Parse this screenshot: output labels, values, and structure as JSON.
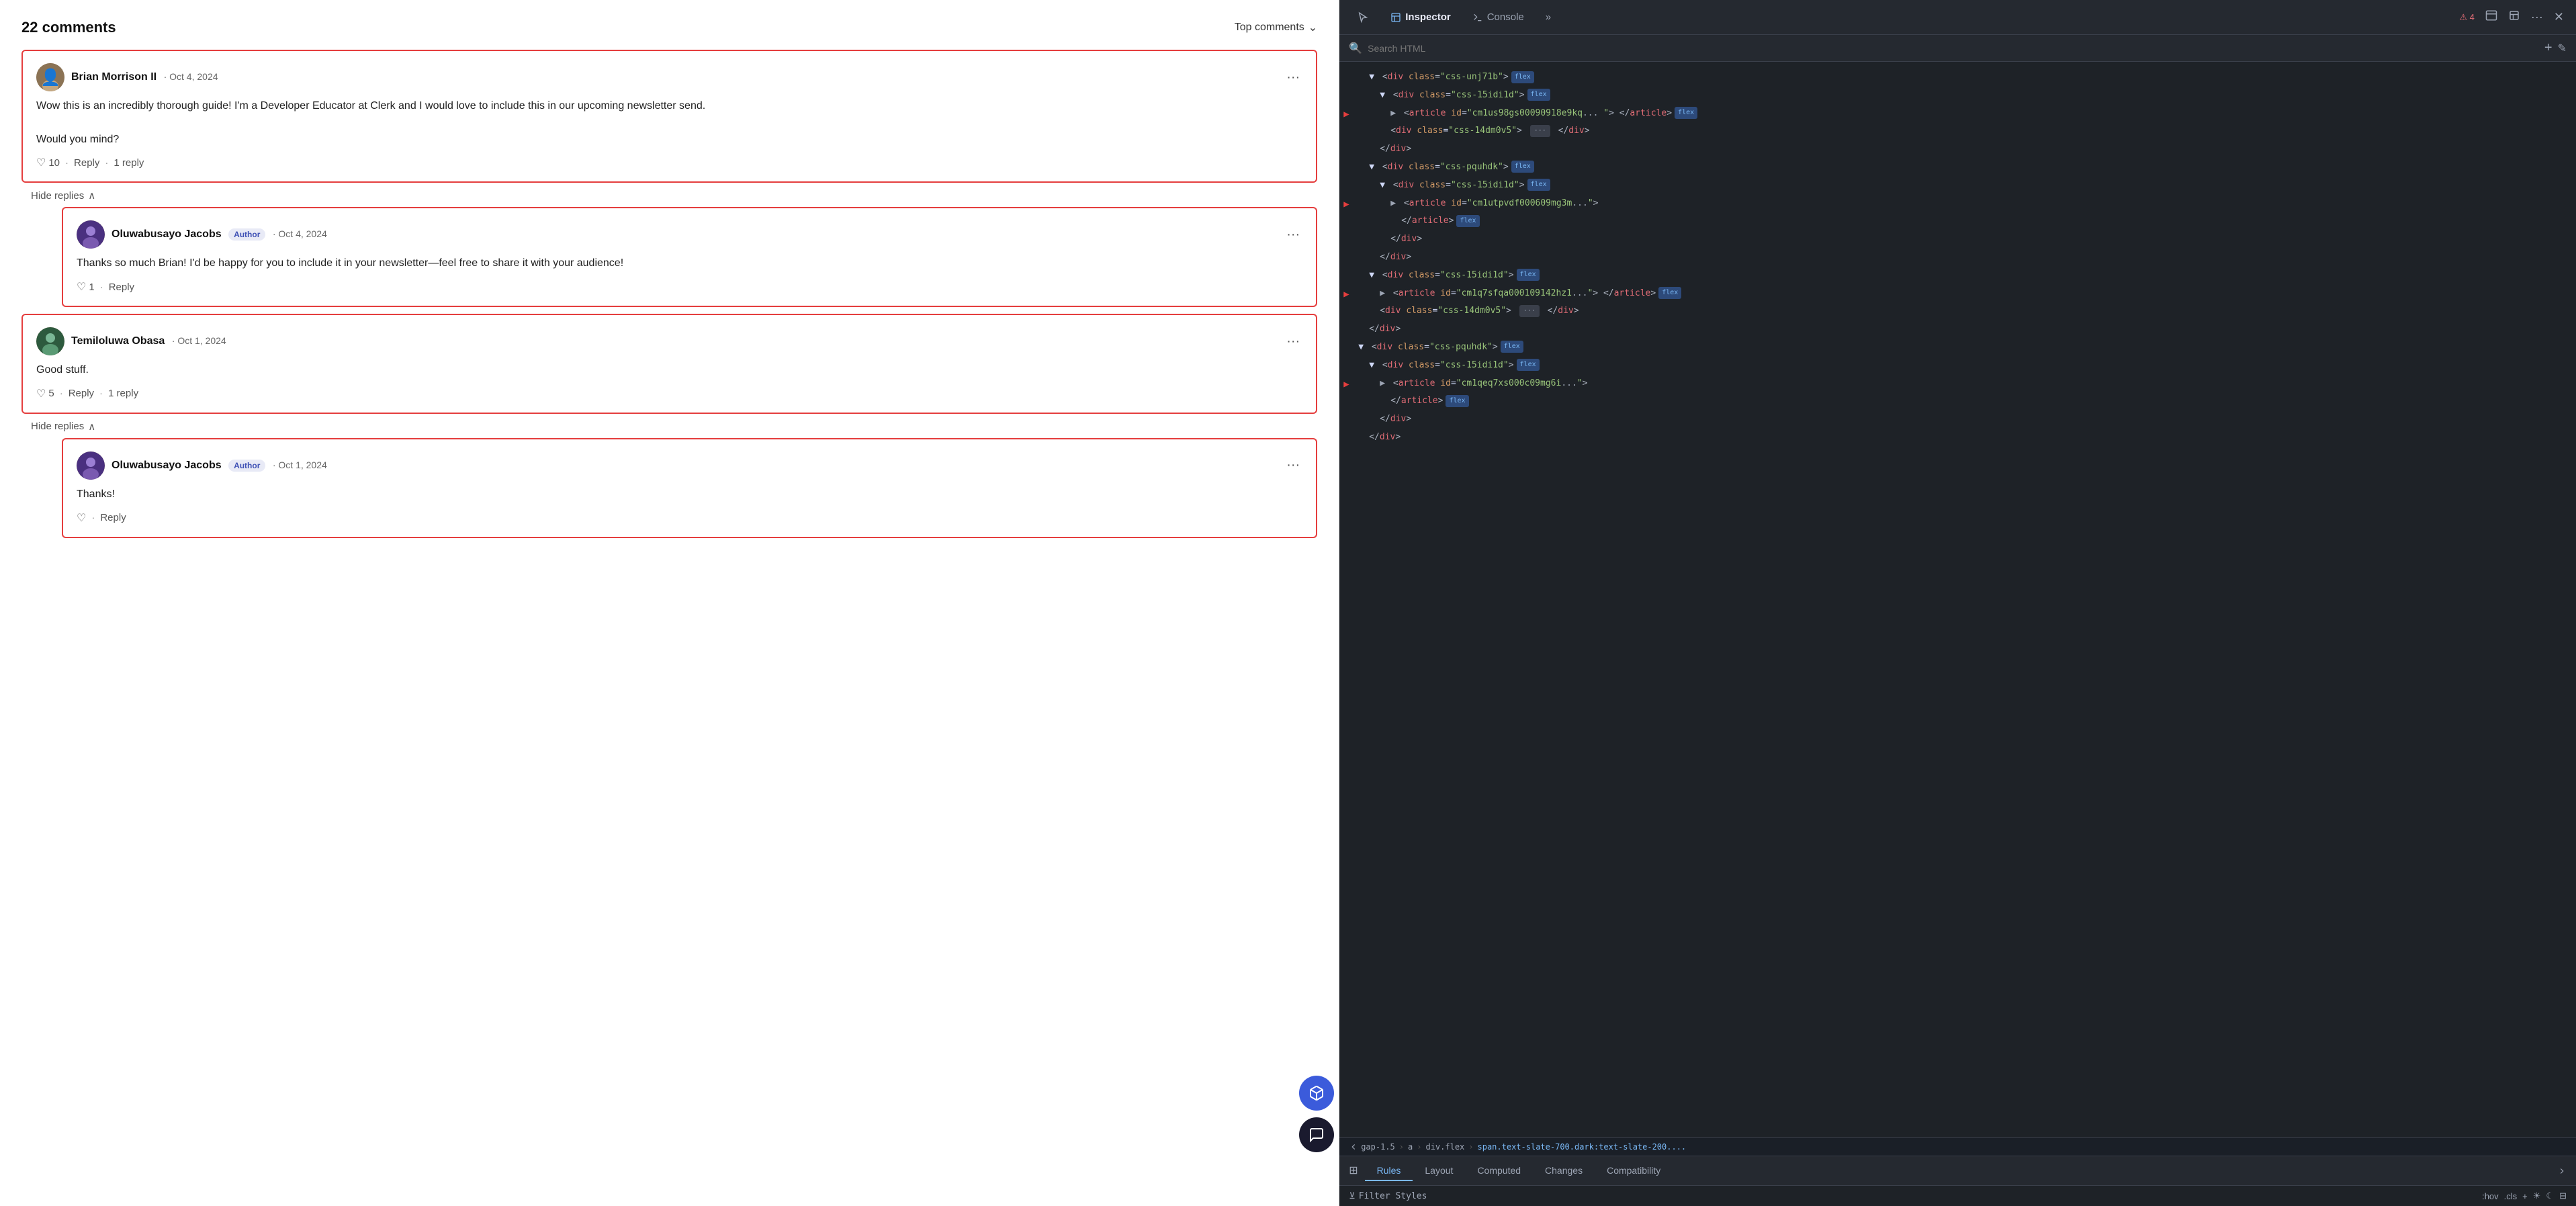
{
  "header": {
    "comments_count": "22 comments",
    "top_comments_label": "Top comments",
    "chevron": "⌄"
  },
  "comments": [
    {
      "id": "comment-1",
      "author": "Brian Morrison II",
      "author_badge": null,
      "date": "Oct 4, 2024",
      "body_lines": [
        "Wow this is an incredibly thorough guide! I'm a Developer Educator at Clerk and I would love to include this in our upcoming newsletter send.",
        "",
        "Would you mind?"
      ],
      "likes": "10",
      "reply_label": "Reply",
      "replies_count": "1 reply",
      "avatar_type": "brian"
    },
    {
      "id": "reply-1",
      "author": "Oluwabusayo Jacobs",
      "author_badge": "Author",
      "date": "Oct 4, 2024",
      "body_lines": [
        "Thanks so much Brian! I'd be happy for you to include it in your newsletter—feel free to share it with your audience!"
      ],
      "likes": "1",
      "reply_label": "Reply",
      "replies_count": null,
      "is_reply": true,
      "avatar_type": "oluwabusayo"
    },
    {
      "id": "comment-2",
      "author": "Temiloluwa Obasa",
      "author_badge": null,
      "date": "Oct 1, 2024",
      "body_lines": [
        "Good stuff."
      ],
      "likes": "5",
      "reply_label": "Reply",
      "replies_count": "1 reply",
      "avatar_type": "temiloluwa"
    },
    {
      "id": "reply-2",
      "author": "Oluwabusayo Jacobs",
      "author_badge": "Author",
      "date": "Oct 1, 2024",
      "body_lines": [
        "Thanks!"
      ],
      "likes": "",
      "reply_label": "Reply",
      "replies_count": null,
      "is_reply": true,
      "avatar_type": "oluwabusayo"
    }
  ],
  "hide_replies_label": "Hide replies",
  "hide_replies_icon": "∧",
  "devtools": {
    "title": "Inspector",
    "tabs": [
      {
        "id": "pick",
        "icon": "⊹",
        "label": ""
      },
      {
        "id": "inspector",
        "label": "Inspector",
        "active": true
      },
      {
        "id": "console",
        "label": "Console"
      },
      {
        "id": "more",
        "icon": "»"
      }
    ],
    "error_badge": "⚠4",
    "search_placeholder": "Search HTML",
    "add_btn": "+",
    "edit_btn": "✎",
    "html_lines": [
      {
        "indent": 2,
        "content": "<div class=\"css-unj71b\">",
        "badge": "flex",
        "type": "open",
        "partial": true
      },
      {
        "indent": 3,
        "content": "<div class=\"css-15idi1d\">",
        "badge": "flex",
        "type": "open"
      },
      {
        "indent": 4,
        "content": "<article id=\"cm1us98gs00090918e9kq...",
        "badge": "flex",
        "type": "arrow-open",
        "arrow": true
      },
      {
        "indent": 5,
        "content": "article>",
        "badge": "flex",
        "type": "close-inline"
      },
      {
        "indent": 4,
        "content": "<div class=\"css-14dm0v5\">",
        "badge": null,
        "dots": true,
        "type": "self-close"
      },
      {
        "indent": 3,
        "content": "</div>",
        "type": "close"
      },
      {
        "indent": 2,
        "content": "<div class=\"css-pquhdk\">",
        "badge": "flex",
        "type": "open"
      },
      {
        "indent": 3,
        "content": "<div class=\"css-15idi1d\">",
        "badge": "flex",
        "type": "open"
      },
      {
        "indent": 4,
        "content": "<article id=\"cm1utpvdf000609mg3m...",
        "badge": "flex",
        "type": "arrow-open",
        "arrow": true
      },
      {
        "indent": 5,
        "content": "</article>",
        "badge": "flex",
        "type": "close-inline"
      },
      {
        "indent": 4,
        "content": "</div>",
        "type": "close"
      },
      {
        "indent": 3,
        "content": "</div>",
        "type": "close"
      },
      {
        "indent": 2,
        "content": "<div class=\"css-15idi1d\">",
        "badge": "flex",
        "type": "open"
      },
      {
        "indent": 3,
        "content": "<article id=\"cm1q7sfqa000109142hz1...",
        "badge": "flex",
        "type": "arrow-open",
        "arrow": true
      },
      {
        "indent": 4,
        "content": "article>",
        "badge": "flex",
        "type": "close-inline"
      },
      {
        "indent": 3,
        "content": "<div class=\"css-14dm0v5\">",
        "dots": true,
        "type": "self-close"
      },
      {
        "indent": 2,
        "content": "</div>",
        "type": "close"
      },
      {
        "indent": 1,
        "content": "<div class=\"css-pquhdk\">",
        "badge": "flex",
        "type": "open"
      },
      {
        "indent": 2,
        "content": "<div class=\"css-15idi1d\">",
        "badge": "flex",
        "type": "open"
      },
      {
        "indent": 3,
        "content": "<article id=\"cm1qeq7xs000c09mg6i...",
        "badge": "flex",
        "type": "arrow-open",
        "arrow": true
      },
      {
        "indent": 4,
        "content": "</article>",
        "badge": "flex",
        "type": "close-inline"
      },
      {
        "indent": 3,
        "content": "</div>",
        "type": "close"
      },
      {
        "indent": 2,
        "content": "</div>",
        "type": "close"
      }
    ],
    "breadcrumb": [
      {
        "label": "gap-1.5",
        "active": false
      },
      {
        "label": "a",
        "active": false
      },
      {
        "label": "div.flex",
        "active": false
      },
      {
        "label": "span.text-slate-700.dark:text-slate-200....",
        "active": true
      }
    ],
    "bottom_tabs": [
      {
        "id": "rules",
        "label": "Rules",
        "active": true,
        "icon": "⊞"
      },
      {
        "id": "layout",
        "label": "Layout",
        "active": false
      },
      {
        "id": "computed",
        "label": "Computed",
        "active": false
      },
      {
        "id": "changes",
        "label": "Changes",
        "active": false
      },
      {
        "id": "compatibility",
        "label": "Compatibility",
        "active": false
      }
    ],
    "filter_styles_label": "Filter Styles",
    "filter_icon": "⊻",
    "filter_actions": [
      ":hov",
      ".cls",
      "+",
      "☀",
      "☾",
      "⊟"
    ]
  },
  "fab_buttons": [
    {
      "id": "fab-blue",
      "icon": "⊞",
      "color": "blue"
    },
    {
      "id": "fab-dark",
      "icon": "💬",
      "color": "dark"
    }
  ]
}
